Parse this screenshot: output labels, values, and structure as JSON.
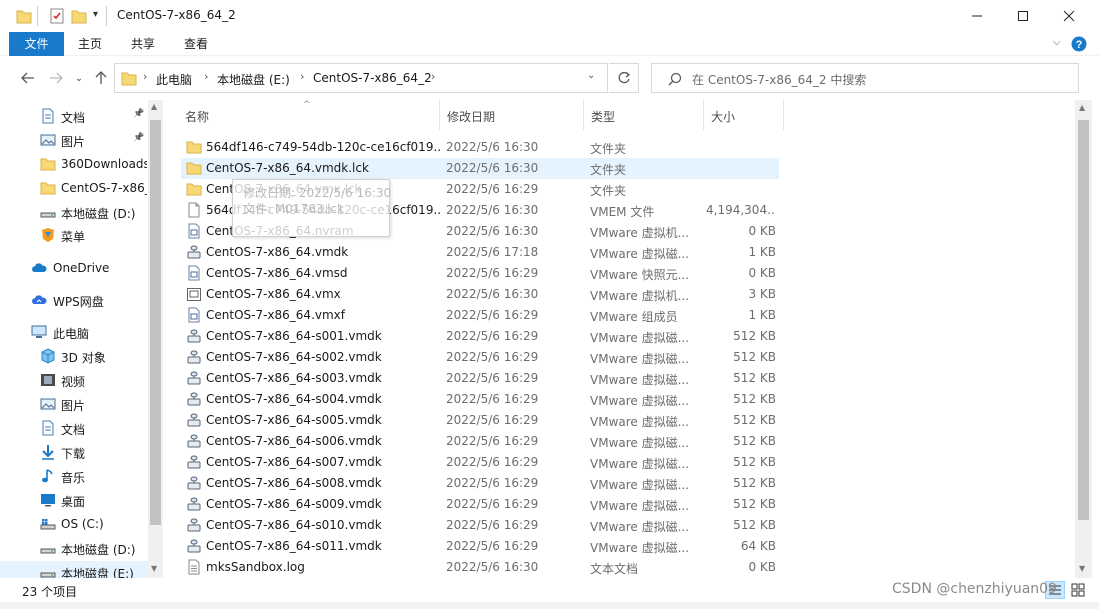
{
  "window": {
    "title": "CentOS-7-x86_64_2"
  },
  "ribbon": {
    "tabs": [
      "文件",
      "主页",
      "共享",
      "查看"
    ]
  },
  "address": {
    "crumbs": [
      "此电脑",
      "本地磁盘 (E:)",
      "CentOS-7-x86_64_2"
    ]
  },
  "search": {
    "placeholder": "在 CentOS-7-x86_64_2 中搜索"
  },
  "sidebar": {
    "items": [
      {
        "label": "文档",
        "icon": "document-icon",
        "pinned": true
      },
      {
        "label": "图片",
        "icon": "pictures-icon",
        "pinned": true
      },
      {
        "label": "360Downloads",
        "icon": "folder-icon"
      },
      {
        "label": "CentOS-7-x86_64",
        "icon": "folder-icon"
      },
      {
        "label": "本地磁盘 (D:)",
        "icon": "drive-icon"
      },
      {
        "label": "菜单",
        "icon": "app-icon"
      },
      {
        "label": "OneDrive",
        "icon": "onedrive-icon"
      },
      {
        "label": "WPS网盘",
        "icon": "cloud-icon"
      },
      {
        "label": "此电脑",
        "icon": "computer-icon"
      },
      {
        "label": "3D 对象",
        "icon": "cube-icon"
      },
      {
        "label": "视频",
        "icon": "video-icon"
      },
      {
        "label": "图片",
        "icon": "pictures-icon"
      },
      {
        "label": "文档",
        "icon": "document-icon"
      },
      {
        "label": "下载",
        "icon": "download-icon"
      },
      {
        "label": "音乐",
        "icon": "music-icon"
      },
      {
        "label": "桌面",
        "icon": "desktop-icon"
      },
      {
        "label": "OS (C:)",
        "icon": "windows-drive-icon"
      },
      {
        "label": "本地磁盘 (D:)",
        "icon": "drive-icon"
      },
      {
        "label": "本地磁盘 (E:)",
        "icon": "drive-icon",
        "selected": true
      }
    ]
  },
  "columns": {
    "name": "名称",
    "date": "修改日期",
    "type": "类型",
    "size": "大小"
  },
  "files": [
    {
      "name": "564df146-c749-54db-120c-ce16cf019...",
      "date": "2022/5/6 16:30",
      "type": "文件夹",
      "size": "",
      "icon": "folder-icon"
    },
    {
      "name": "CentOS-7-x86_64.vmdk.lck",
      "date": "2022/5/6 16:30",
      "type": "文件夹",
      "size": "",
      "icon": "folder-icon",
      "hover": true
    },
    {
      "name": "CentOS-7-x86_64.vmx.lck",
      "date": "2022/5/6 16:29",
      "type": "文件夹",
      "size": "",
      "icon": "folder-icon"
    },
    {
      "name": "564df146-c749-54db-120c-ce16cf019...",
      "date": "2022/5/6 16:30",
      "type": "VMEM 文件",
      "size": "4,194,304...",
      "icon": "blank-file-icon"
    },
    {
      "name": "CentOS-7-x86_64.nvram",
      "date": "2022/5/6 16:30",
      "type": "VMware 虚拟机...",
      "size": "0 KB",
      "icon": "vm-file-icon"
    },
    {
      "name": "CentOS-7-x86_64.vmdk",
      "date": "2022/5/6 17:18",
      "type": "VMware 虚拟磁...",
      "size": "1 KB",
      "icon": "disk-file-icon"
    },
    {
      "name": "CentOS-7-x86_64.vmsd",
      "date": "2022/5/6 16:29",
      "type": "VMware 快照元...",
      "size": "0 KB",
      "icon": "vm-file-icon"
    },
    {
      "name": "CentOS-7-x86_64.vmx",
      "date": "2022/5/6 16:30",
      "type": "VMware 虚拟机...",
      "size": "3 KB",
      "icon": "vmx-file-icon"
    },
    {
      "name": "CentOS-7-x86_64.vmxf",
      "date": "2022/5/6 16:29",
      "type": "VMware 组成员",
      "size": "1 KB",
      "icon": "vm-file-icon"
    },
    {
      "name": "CentOS-7-x86_64-s001.vmdk",
      "date": "2022/5/6 16:29",
      "type": "VMware 虚拟磁...",
      "size": "512 KB",
      "icon": "disk-file-icon"
    },
    {
      "name": "CentOS-7-x86_64-s002.vmdk",
      "date": "2022/5/6 16:29",
      "type": "VMware 虚拟磁...",
      "size": "512 KB",
      "icon": "disk-file-icon"
    },
    {
      "name": "CentOS-7-x86_64-s003.vmdk",
      "date": "2022/5/6 16:29",
      "type": "VMware 虚拟磁...",
      "size": "512 KB",
      "icon": "disk-file-icon"
    },
    {
      "name": "CentOS-7-x86_64-s004.vmdk",
      "date": "2022/5/6 16:29",
      "type": "VMware 虚拟磁...",
      "size": "512 KB",
      "icon": "disk-file-icon"
    },
    {
      "name": "CentOS-7-x86_64-s005.vmdk",
      "date": "2022/5/6 16:29",
      "type": "VMware 虚拟磁...",
      "size": "512 KB",
      "icon": "disk-file-icon"
    },
    {
      "name": "CentOS-7-x86_64-s006.vmdk",
      "date": "2022/5/6 16:29",
      "type": "VMware 虚拟磁...",
      "size": "512 KB",
      "icon": "disk-file-icon"
    },
    {
      "name": "CentOS-7-x86_64-s007.vmdk",
      "date": "2022/5/6 16:29",
      "type": "VMware 虚拟磁...",
      "size": "512 KB",
      "icon": "disk-file-icon"
    },
    {
      "name": "CentOS-7-x86_64-s008.vmdk",
      "date": "2022/5/6 16:29",
      "type": "VMware 虚拟磁...",
      "size": "512 KB",
      "icon": "disk-file-icon"
    },
    {
      "name": "CentOS-7-x86_64-s009.vmdk",
      "date": "2022/5/6 16:29",
      "type": "VMware 虚拟磁...",
      "size": "512 KB",
      "icon": "disk-file-icon"
    },
    {
      "name": "CentOS-7-x86_64-s010.vmdk",
      "date": "2022/5/6 16:29",
      "type": "VMware 虚拟磁...",
      "size": "512 KB",
      "icon": "disk-file-icon"
    },
    {
      "name": "CentOS-7-x86_64-s011.vmdk",
      "date": "2022/5/6 16:29",
      "type": "VMware 虚拟磁...",
      "size": "64 KB",
      "icon": "disk-file-icon"
    },
    {
      "name": "mksSandbox.log",
      "date": "2022/5/6 16:30",
      "type": "文本文档",
      "size": "0 KB",
      "icon": "text-file-icon"
    }
  ],
  "tooltip": {
    "line1": "修改日期: 2022/5/6 16:30",
    "line2": "文件: M01763.lck"
  },
  "status": {
    "item_count": "23 个项目"
  },
  "watermark": "CSDN @chenzhiyuan09",
  "colors": {
    "accent": "#1979ca",
    "hover": "#e5f3ff",
    "folder": "#f8d775"
  }
}
